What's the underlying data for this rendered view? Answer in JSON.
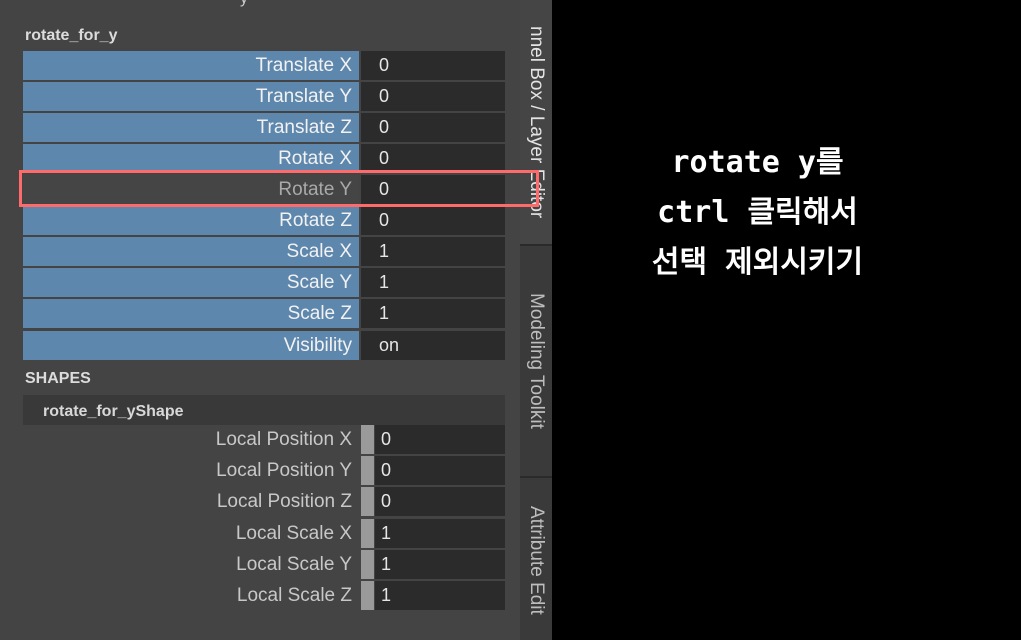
{
  "channel_box": {
    "object_name": "rotate_for_y",
    "top_cut_text": "y",
    "attributes": [
      {
        "label": "Translate X",
        "value": "0"
      },
      {
        "label": "Translate Y",
        "value": "0"
      },
      {
        "label": "Translate Z",
        "value": "0"
      },
      {
        "label": "Rotate X",
        "value": "0"
      },
      {
        "label": "Rotate Y",
        "value": "0"
      },
      {
        "label": "Rotate Z",
        "value": "0"
      },
      {
        "label": "Scale X",
        "value": "1"
      },
      {
        "label": "Scale Y",
        "value": "1"
      },
      {
        "label": "Scale Z",
        "value": "1"
      },
      {
        "label": "Visibility",
        "value": "on"
      }
    ],
    "shapes_title": "SHAPES",
    "shape_name": "rotate_for_yShape",
    "shape_attributes": [
      {
        "label": "Local Position X",
        "value": "0"
      },
      {
        "label": "Local Position Y",
        "value": "0"
      },
      {
        "label": "Local Position Z",
        "value": "0"
      },
      {
        "label": "Local Scale X",
        "value": "1"
      },
      {
        "label": "Local Scale Y",
        "value": "1"
      },
      {
        "label": "Local Scale Z",
        "value": "1"
      }
    ]
  },
  "side_tabs": {
    "channel_box": "nnel Box / Layer Editor",
    "modeling_toolkit": "Modeling Toolkit",
    "attribute_editor": "Attribute Edit"
  },
  "annotation": {
    "line1": "rotate y를",
    "line2": "ctrl 클릭해서",
    "line3": "선택 제외시키기"
  },
  "colors": {
    "keyed_label": "#5e87ad",
    "highlight_border": "#ff6b6b",
    "panel_bg": "#444444",
    "value_bg": "#2b2b2b"
  }
}
